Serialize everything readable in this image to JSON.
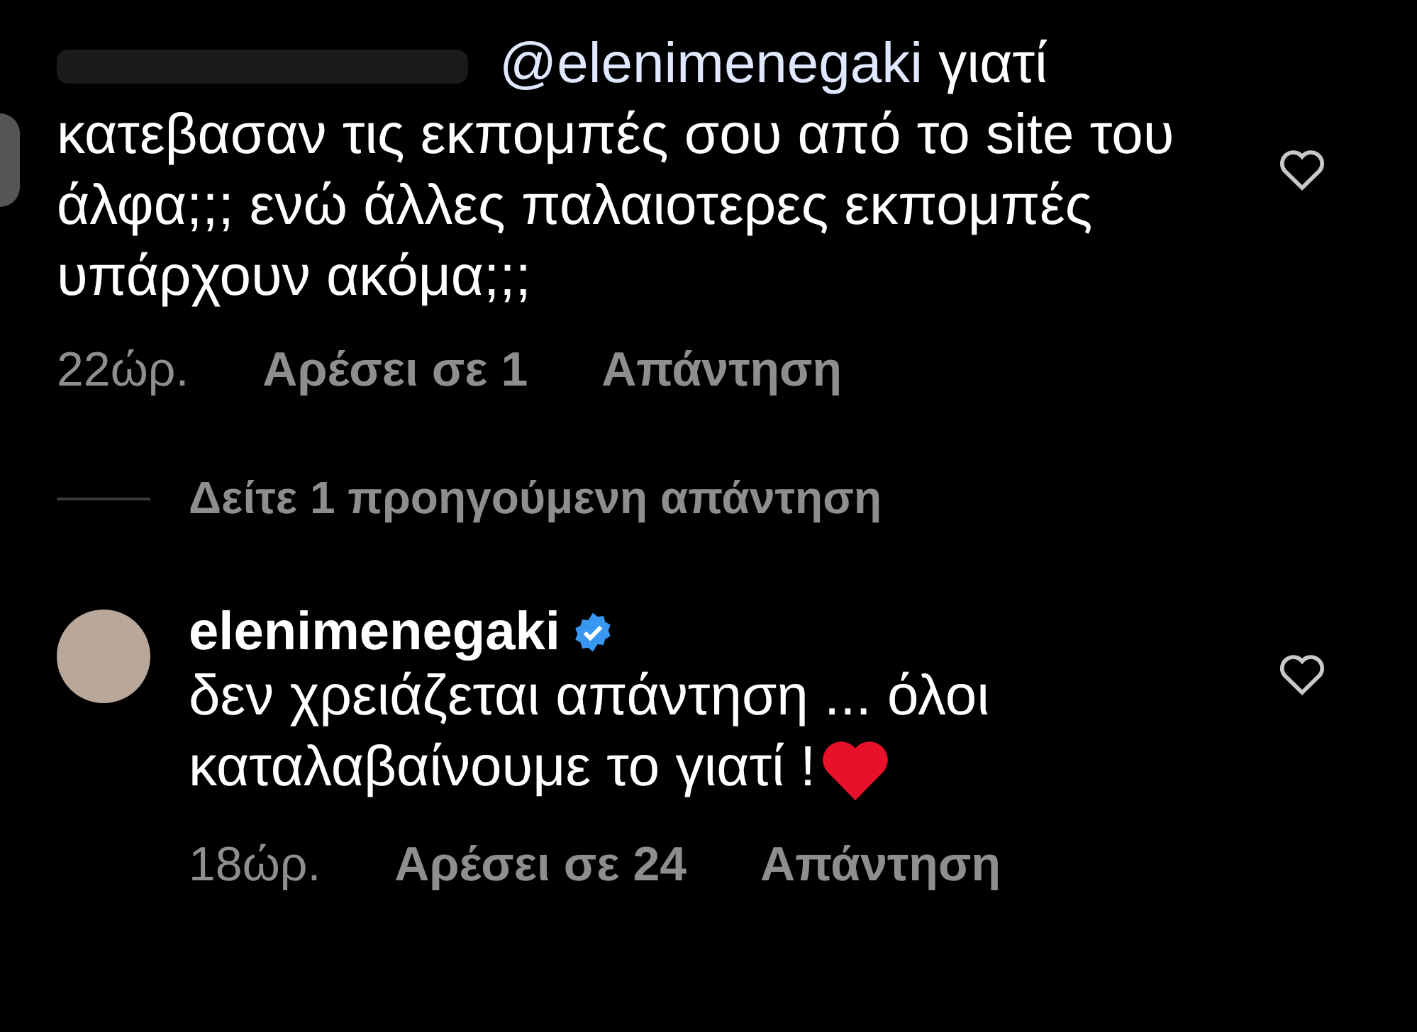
{
  "comments": [
    {
      "username_hidden": true,
      "mention": "@elenimenegaki",
      "text": "γιατί κατεβασαν τις εκπομπές σου από το site του άλφα;;; ενώ άλλες παλαιοτερες εκπομπές υπάρχουν ακόμα;;;",
      "time": "22ώρ.",
      "likes": "Αρέσει σε 1",
      "reply": "Απάντηση",
      "liked": false
    },
    {
      "username": "elenimenegaki",
      "verified": true,
      "text": "δεν χρειάζεται απάντηση ... όλοι καταλαβαίνουμε το γιατί !",
      "heart_emoji": true,
      "time": "18ώρ.",
      "likes": "Αρέσει σε 24",
      "reply": "Απάντηση",
      "liked": false
    }
  ],
  "view_replies": "Δείτε 1 προηγούμενη απάντηση"
}
